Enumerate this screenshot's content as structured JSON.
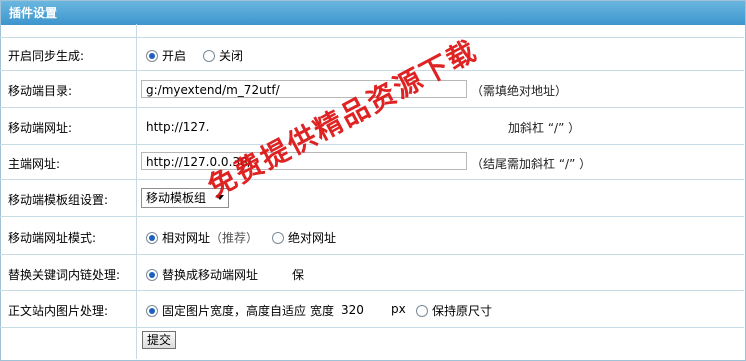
{
  "panel": {
    "title": "插件设置"
  },
  "rows": {
    "sync": {
      "label": "开启同步生成:",
      "opt_on": "开启",
      "opt_off": "关闭"
    },
    "mobile_dir": {
      "label": "移动端目录:",
      "value": "g:/myextend/m_72utf/",
      "hint": "（需填绝对地址）"
    },
    "mobile_url": {
      "label": "移动端网址:",
      "value": "http://127.",
      "hint": "加斜杠 “/” ）"
    },
    "main_url": {
      "label": "主端网址:",
      "value": "http://127.0.0.38/",
      "hint": "（结尾需加斜杠 “/” ）"
    },
    "template": {
      "label": "移动端模板组设置:",
      "selected": "移动模板组"
    },
    "url_mode": {
      "label": "移动端网址模式:",
      "opt_rel": "相对网址",
      "opt_rel_note": "推荐",
      "opt_abs": "绝对网址"
    },
    "keyword": {
      "label": "替换关键词内链处理:",
      "opt_replace": "替换成移动端网址",
      "opt_keep": "保"
    },
    "image": {
      "label": "正文站内图片处理:",
      "opt_fixed": "固定图片宽度",
      "opt_auto": "高度自适应",
      "width_label": "宽度",
      "width_value": "320",
      "unit": "px",
      "opt_original": "保持原尺寸"
    }
  },
  "submit": {
    "label": "提交"
  },
  "watermark": {
    "text": "免费提供精品资源下载"
  }
}
